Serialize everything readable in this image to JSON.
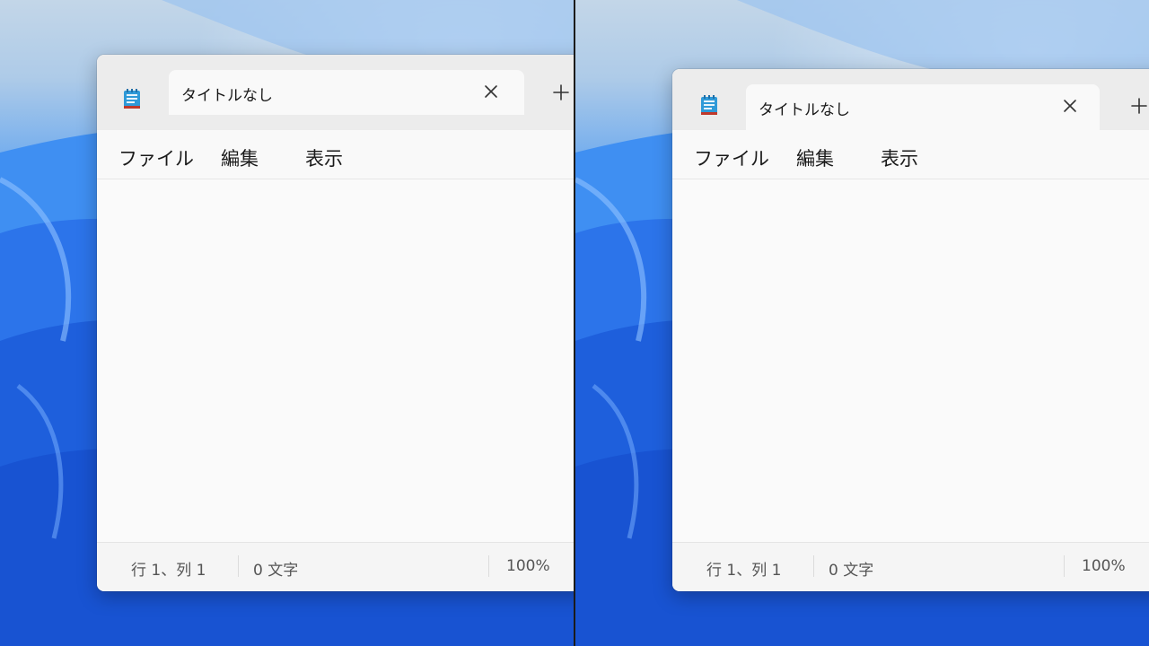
{
  "screenshots": [
    {
      "tab": {
        "title": "タイトルなし"
      },
      "menu": {
        "file": "ファイル",
        "edit": "編集",
        "view": "表示"
      },
      "status": {
        "position": "行 1、列 1",
        "chars": "0 文字",
        "zoom": "100%"
      }
    },
    {
      "tab": {
        "title": "タイトルなし"
      },
      "menu": {
        "file": "ファイル",
        "edit": "編集",
        "view": "表示"
      },
      "status": {
        "position": "行 1、列 1",
        "chars": "0 文字",
        "zoom": "100%"
      }
    }
  ],
  "icons": {
    "app": "notepad-icon",
    "close": "close-icon",
    "new_tab": "plus-icon"
  },
  "colors": {
    "window_bg": "#f9f9f9",
    "titlebar_bg": "#ececec",
    "wallpaper_blue": "#1f62e0"
  }
}
